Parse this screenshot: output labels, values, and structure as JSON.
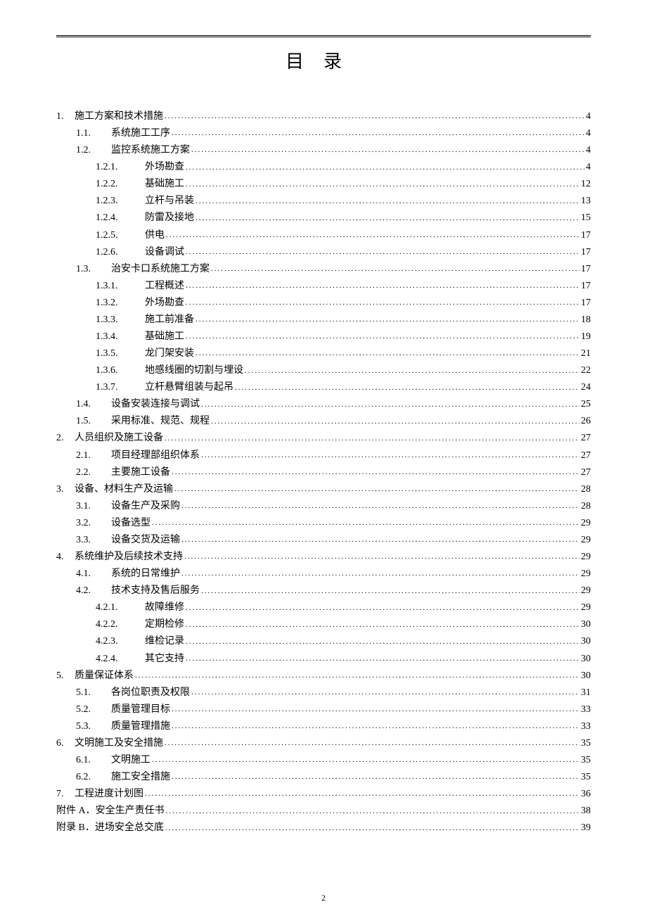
{
  "title": "目录",
  "page_number": "2",
  "toc": [
    {
      "level": 0,
      "num": "1.",
      "label": "施工方案和技术措施",
      "page": "4"
    },
    {
      "level": 1,
      "num": "1.1.",
      "label": "系统施工工序",
      "page": "4"
    },
    {
      "level": 1,
      "num": "1.2.",
      "label": "监控系统施工方案",
      "page": "4"
    },
    {
      "level": 2,
      "num": "1.2.1.",
      "label": "外场勘查",
      "page": "4"
    },
    {
      "level": 2,
      "num": "1.2.2.",
      "label": "基础施工",
      "page": "12"
    },
    {
      "level": 2,
      "num": "1.2.3.",
      "label": "立杆与吊装",
      "page": "13"
    },
    {
      "level": 2,
      "num": "1.2.4.",
      "label": "防雷及接地",
      "page": "15"
    },
    {
      "level": 2,
      "num": "1.2.5.",
      "label": "供电",
      "page": "17"
    },
    {
      "level": 2,
      "num": "1.2.6.",
      "label": "设备调试",
      "page": "17"
    },
    {
      "level": 1,
      "num": "1.3.",
      "label": "治安卡口系统施工方案",
      "page": "17"
    },
    {
      "level": 2,
      "num": "1.3.1.",
      "label": "工程概述",
      "page": "17"
    },
    {
      "level": 2,
      "num": "1.3.2.",
      "label": "外场勘查",
      "page": "17"
    },
    {
      "level": 2,
      "num": "1.3.3.",
      "label": "施工前准备",
      "page": "18"
    },
    {
      "level": 2,
      "num": "1.3.4.",
      "label": "基础施工",
      "page": "19"
    },
    {
      "level": 2,
      "num": "1.3.5.",
      "label": "龙门架安装",
      "page": "21"
    },
    {
      "level": 2,
      "num": "1.3.6.",
      "label": "地感线圈的切割与埋设",
      "page": "22"
    },
    {
      "level": 2,
      "num": "1.3.7.",
      "label": "立杆悬臂组装与起吊",
      "page": "24"
    },
    {
      "level": 1,
      "num": "1.4.",
      "label": "设备安装连接与调试",
      "page": "25"
    },
    {
      "level": 1,
      "num": "1.5.",
      "label": "采用标准、规范、规程",
      "page": "26"
    },
    {
      "level": 0,
      "num": "2.",
      "label": "人员组织及施工设备",
      "page": "27"
    },
    {
      "level": 1,
      "num": "2.1.",
      "label": "项目经理部组织体系",
      "page": "27"
    },
    {
      "level": 1,
      "num": "2.2.",
      "label": "主要施工设备",
      "page": "27"
    },
    {
      "level": 0,
      "num": "3.",
      "label": "设备、材料生产及运输",
      "page": "28"
    },
    {
      "level": 1,
      "num": "3.1.",
      "label": "设备生产及采购",
      "page": "28"
    },
    {
      "level": 1,
      "num": "3.2.",
      "label": "设备选型",
      "page": "29"
    },
    {
      "level": 1,
      "num": "3.3.",
      "label": "设备交货及运输",
      "page": "29"
    },
    {
      "level": 0,
      "num": "4.",
      "label": "系统维护及后续技术支持",
      "page": "29"
    },
    {
      "level": 1,
      "num": "4.1.",
      "label": "系统的日常维护",
      "page": "29"
    },
    {
      "level": 1,
      "num": "4.2.",
      "label": "技术支持及售后服务",
      "page": "29"
    },
    {
      "level": 2,
      "num": "4.2.1.",
      "label": "故障维修",
      "page": "29"
    },
    {
      "level": 2,
      "num": "4.2.2.",
      "label": "定期检修",
      "page": "30"
    },
    {
      "level": 2,
      "num": "4.2.3.",
      "label": "维检记录",
      "page": "30"
    },
    {
      "level": 2,
      "num": "4.2.4.",
      "label": "其它支持",
      "page": "30"
    },
    {
      "level": 0,
      "num": "5.",
      "label": "质量保证体系",
      "page": "30"
    },
    {
      "level": 1,
      "num": "5.1.",
      "label": "各岗位职责及权限",
      "page": "31"
    },
    {
      "level": 1,
      "num": "5.2.",
      "label": "质量管理目标",
      "page": "33"
    },
    {
      "level": 1,
      "num": "5.3.",
      "label": "质量管理措施",
      "page": "33"
    },
    {
      "level": 0,
      "num": "6.",
      "label": "文明施工及安全措施",
      "page": "35"
    },
    {
      "level": 1,
      "num": "6.1.",
      "label": "文明施工",
      "page": "35"
    },
    {
      "level": 1,
      "num": "6.2.",
      "label": "施工安全措施",
      "page": "35"
    },
    {
      "level": 0,
      "num": "7.",
      "label": "工程进度计划图",
      "page": "36"
    },
    {
      "level": 0,
      "num": "附件 A．",
      "label": "安全生产责任书",
      "page": "38"
    },
    {
      "level": 0,
      "num": "附录 B．",
      "label": "进场安全总交底",
      "page": "39"
    }
  ]
}
